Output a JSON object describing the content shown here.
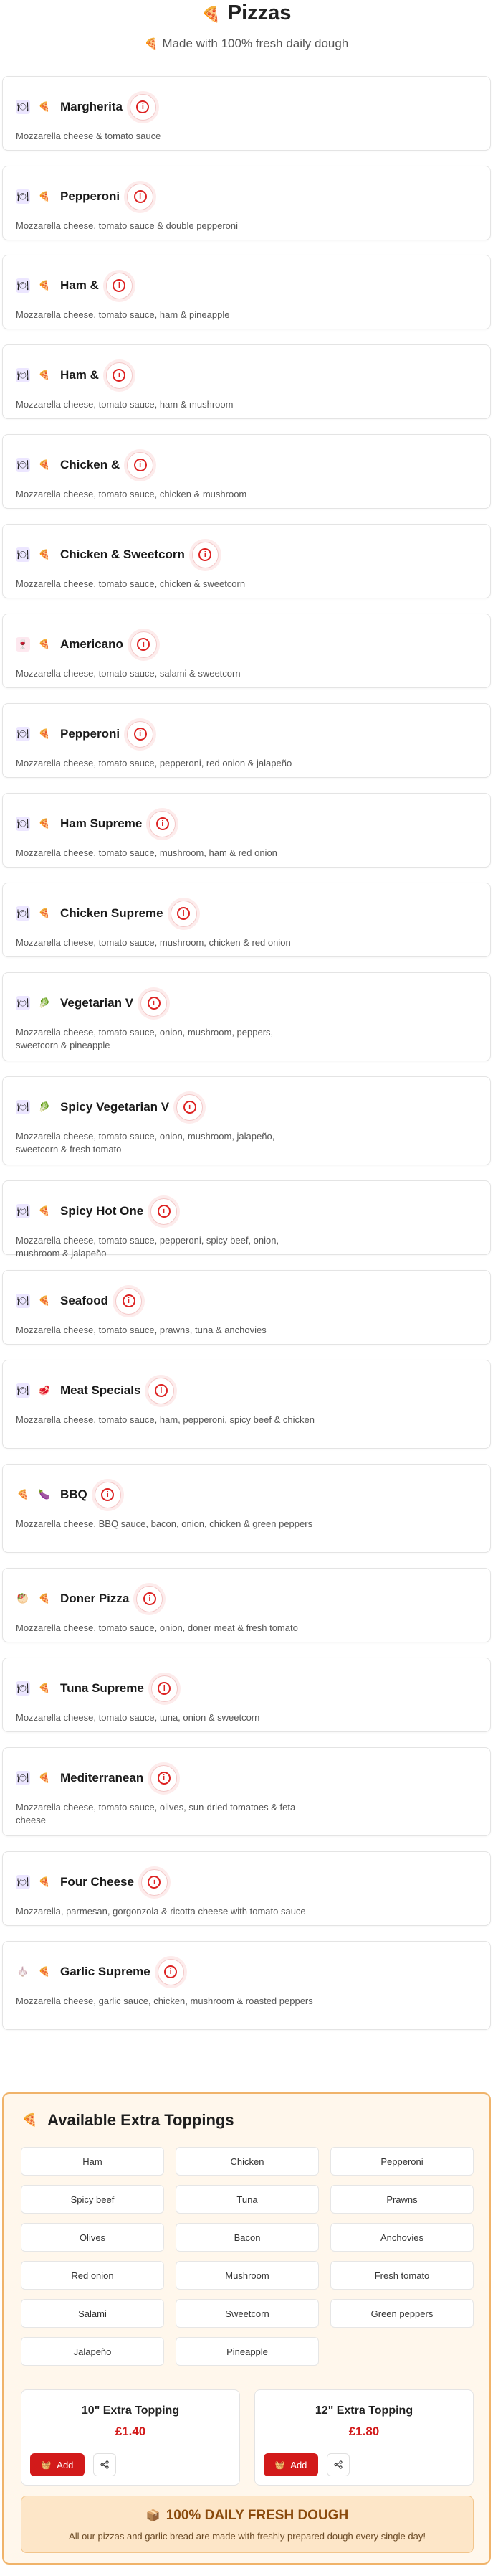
{
  "header": {
    "title_icon": "pizza-icon",
    "title": "Pizzas",
    "subtitle_icon": "pizza-icon",
    "subtitle": "Made with 100% fresh daily dough"
  },
  "colors": {
    "accent": "#d21a1a",
    "toppings_border": "#f0b36a",
    "toppings_bg": "#fff7ec",
    "fresh_bg": "#fde6c8"
  },
  "pizzas": [
    {
      "name": "Margherita",
      "desc": "Mozzarella cheese & tomato sauce",
      "icons": [
        "dish-icon",
        "pizza-icon"
      ]
    },
    {
      "name": "Pepperoni",
      "desc": "Mozzarella cheese, tomato sauce & double pepperoni",
      "icons": [
        "dish-icon",
        "pizza-icon"
      ]
    },
    {
      "name": "Ham &",
      "desc": "Mozzarella cheese, tomato sauce, ham & pineapple",
      "icons": [
        "dish-icon",
        "pizza-icon"
      ]
    },
    {
      "name": "Ham &",
      "desc": "Mozzarella cheese, tomato sauce, ham & mushroom",
      "icons": [
        "dish-icon",
        "pizza-icon"
      ]
    },
    {
      "name": "Chicken &",
      "desc": "Mozzarella cheese, tomato sauce, chicken & mushroom",
      "icons": [
        "dish-icon",
        "pizza-icon"
      ]
    },
    {
      "name": "Chicken & Sweetcorn",
      "desc": "Mozzarella cheese, tomato sauce, chicken & sweetcorn",
      "icons": [
        "dish-icon",
        "pizza-icon"
      ]
    },
    {
      "name": "Americano",
      "desc": "Mozzarella cheese, tomato sauce, salami & sweetcorn",
      "icons": [
        "drink-icon",
        "pizza-icon"
      ]
    },
    {
      "name": "Pepperoni",
      "desc": "Mozzarella cheese, tomato sauce, pepperoni, red onion & jalapeño",
      "icons": [
        "dish-icon",
        "pizza-icon"
      ]
    },
    {
      "name": "Ham Supreme",
      "desc": "Mozzarella cheese, tomato sauce, mushroom, ham & red onion",
      "icons": [
        "dish-icon",
        "pizza-icon"
      ]
    },
    {
      "name": "Chicken Supreme",
      "desc": "Mozzarella cheese, tomato sauce, mushroom, chicken & red onion",
      "icons": [
        "dish-icon",
        "pizza-icon"
      ]
    },
    {
      "name": "Vegetarian V",
      "desc": "Mozzarella cheese, tomato sauce, onion, mushroom, peppers, sweetcorn & pineapple",
      "icons": [
        "dish-icon",
        "leaf-icon"
      ]
    },
    {
      "name": "Spicy Vegetarian V",
      "desc": "Mozzarella cheese, tomato sauce, onion, mushroom, jalapeño, sweetcorn & fresh tomato",
      "icons": [
        "dish-icon",
        "leaf-icon"
      ]
    },
    {
      "name": "Spicy Hot One",
      "desc": "Mozzarella cheese, tomato sauce, pepperoni, spicy beef, onion, mushroom & jalapeño",
      "icons": [
        "dish-icon",
        "pizza-icon"
      ]
    },
    {
      "name": "Seafood",
      "desc": "Mozzarella cheese, tomato sauce, prawns, tuna & anchovies",
      "icons": [
        "dish-icon",
        "pizza-icon"
      ]
    },
    {
      "name": "Meat Specials",
      "desc": "Mozzarella cheese, tomato sauce, ham, pepperoni, spicy beef & chicken",
      "icons": [
        "dish-icon",
        "meat-icon"
      ]
    },
    {
      "name": "BBQ",
      "desc": "Mozzarella cheese, BBQ sauce, bacon, onion, chicken & green peppers",
      "icons": [
        "pizza-icon",
        "eggplant-icon"
      ]
    },
    {
      "name": "Doner Pizza",
      "desc": "Mozzarella cheese, tomato sauce, onion, doner meat & fresh tomato",
      "icons": [
        "kebab-icon",
        "pizza-icon"
      ]
    },
    {
      "name": "Tuna Supreme",
      "desc": "Mozzarella cheese, tomato sauce, tuna, onion & sweetcorn",
      "icons": [
        "dish-icon",
        "pizza-icon"
      ]
    },
    {
      "name": "Mediterranean",
      "desc": "Mozzarella cheese, tomato sauce, olives, sun-dried tomatoes & feta cheese",
      "icons": [
        "dish-icon",
        "pizza-icon"
      ]
    },
    {
      "name": "Four Cheese",
      "desc": "Mozzarella, parmesan, gorgonzola & ricotta cheese with tomato sauce",
      "icons": [
        "dish-icon",
        "pizza-icon"
      ]
    },
    {
      "name": "Garlic Supreme",
      "desc": "Mozzarella cheese, garlic sauce, chicken, mushroom & roasted peppers",
      "icons": [
        "garlic-icon",
        "pizza-icon"
      ]
    }
  ],
  "toppings": {
    "title_icon": "pizza-icon",
    "title": "Available Extra Toppings",
    "items": [
      "Ham",
      "Chicken",
      "Pepperoni",
      "Spicy beef",
      "Tuna",
      "Prawns",
      "Olives",
      "Bacon",
      "Anchovies",
      "Red onion",
      "Mushroom",
      "Fresh tomato",
      "Salami",
      "Sweetcorn",
      "Green peppers",
      "Jalapeño",
      "Pineapple"
    ],
    "extras": [
      {
        "title": "10\" Extra Topping",
        "price": "£1.40",
        "add_label": "Add"
      },
      {
        "title": "12\" Extra Topping",
        "price": "£1.80",
        "add_label": "Add"
      }
    ],
    "fresh": {
      "icon": "box-icon",
      "title": "100% DAILY FRESH DOUGH",
      "text": "All our pizzas and garlic bread are made with freshly prepared dough every single day!"
    }
  }
}
